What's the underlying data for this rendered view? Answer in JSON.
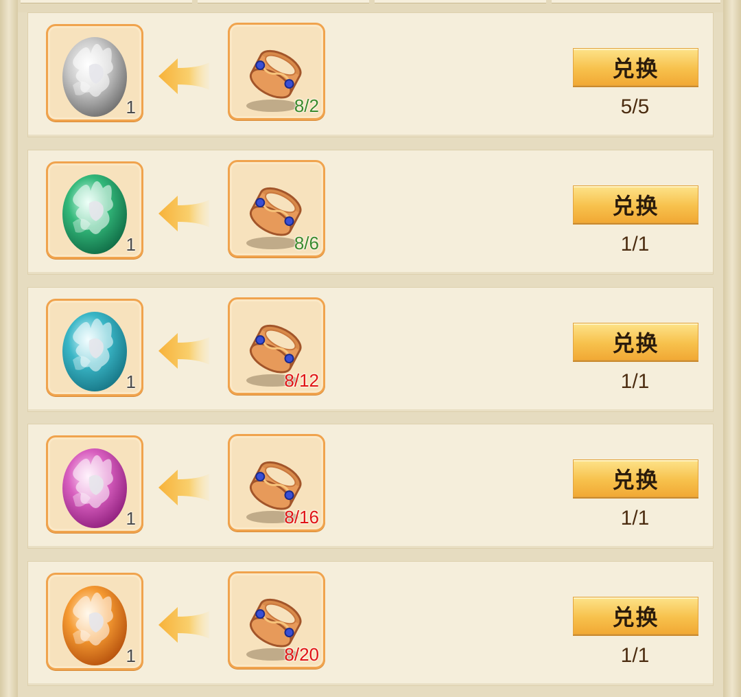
{
  "colors": {
    "qty_enough": "#3a8a2c",
    "qty_short": "#e01414"
  },
  "rows": [
    {
      "reward_icon": "silver-dragon-egg-icon",
      "reward_qty": "1",
      "cost_icon": "gold-ring-icon",
      "cost_text": "8/2",
      "cost_status": "enough",
      "button_label": "兑换",
      "count": "5/5"
    },
    {
      "reward_icon": "green-dragon-egg-icon",
      "reward_qty": "1",
      "cost_icon": "gold-ring-icon",
      "cost_text": "8/6",
      "cost_status": "enough",
      "button_label": "兑换",
      "count": "1/1"
    },
    {
      "reward_icon": "cyan-dragon-egg-icon",
      "reward_qty": "1",
      "cost_icon": "gold-ring-icon",
      "cost_text": "8/12",
      "cost_status": "short",
      "button_label": "兑换",
      "count": "1/1"
    },
    {
      "reward_icon": "pink-dragon-egg-icon",
      "reward_qty": "1",
      "cost_icon": "gold-ring-icon",
      "cost_text": "8/16",
      "cost_status": "short",
      "button_label": "兑换",
      "count": "1/1"
    },
    {
      "reward_icon": "orange-dragon-egg-icon",
      "reward_qty": "1",
      "cost_icon": "gold-ring-icon",
      "cost_text": "8/20",
      "cost_status": "short",
      "button_label": "兑换",
      "count": "1/1"
    }
  ]
}
